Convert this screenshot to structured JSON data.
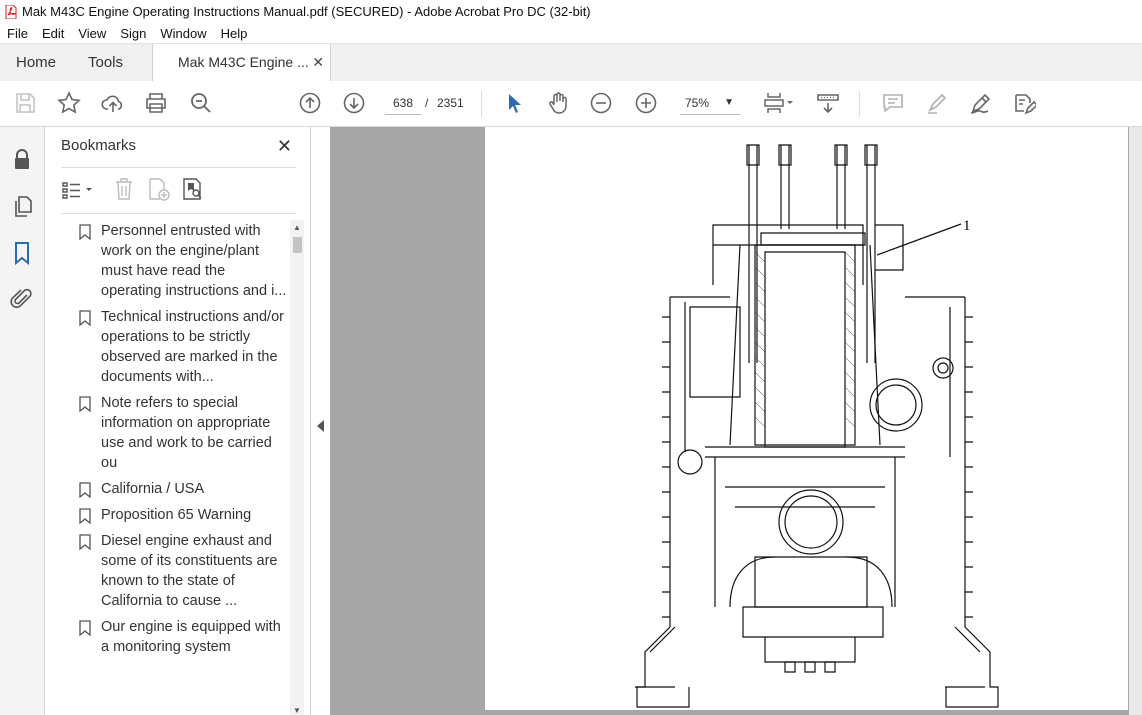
{
  "window": {
    "title": "Mak M43C Engine Operating Instructions Manual.pdf (SECURED) - Adobe Acrobat Pro DC (32-bit)"
  },
  "menu": [
    "File",
    "Edit",
    "View",
    "Sign",
    "Window",
    "Help"
  ],
  "tabs": {
    "home": "Home",
    "tools": "Tools",
    "document": "Mak M43C Engine ...",
    "close_glyph": "✕"
  },
  "toolbar": {
    "current_page": "638",
    "page_separator": "/",
    "total_pages": "2351",
    "zoom": "75%",
    "icons": [
      "save-icon",
      "bookmark-star-icon",
      "upload-icon",
      "print-icon",
      "find-icon",
      "previous-page-icon",
      "next-page-icon",
      "select-cursor-icon",
      "hand-icon",
      "zoom-out-icon",
      "zoom-in-icon",
      "fit-page-icon",
      "scroll-mode-icon",
      "comment-icon",
      "highlight-icon",
      "sign-icon",
      "redact-icon"
    ]
  },
  "left_rail": {
    "icons": [
      "lock-icon",
      "pages-icon",
      "bookmarks-icon",
      "attachment-icon"
    ],
    "active": "bookmarks-icon"
  },
  "bookmarks": {
    "title": "Bookmarks",
    "close_glyph": "✕",
    "items": [
      {
        "label": "Personnel entrusted with work on the engine/plant must have read the operating instructions and i..."
      },
      {
        "label": "Technical instructions and/or operations to be strictly observed are marked in the documents with..."
      },
      {
        "label": "Note refers to special information on appropriate use and work to be carried ou"
      },
      {
        "label": "California / USA"
      },
      {
        "label": "Proposition 65 Warning"
      },
      {
        "label": "Diesel engine exhaust and some of its constituents are known to the state of California to cause ..."
      },
      {
        "label": "Our engine is equipped with a monitoring system"
      }
    ]
  },
  "document": {
    "callout_label": "1"
  },
  "colors": {
    "accent_blue": "#2b6cb0",
    "icon_gray": "#6b6b6b",
    "doc_background": "#a6a6a6"
  }
}
